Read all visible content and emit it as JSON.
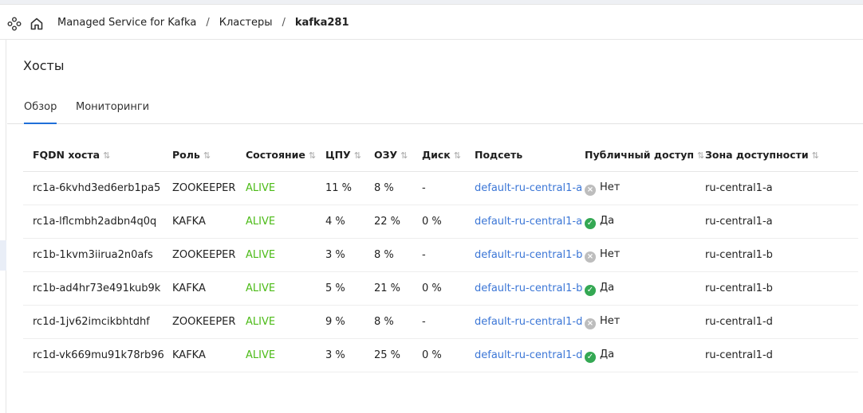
{
  "breadcrumb": {
    "items": [
      "Managed Service for Kafka",
      "Кластеры"
    ],
    "separator": "/",
    "current": "kafka281"
  },
  "page": {
    "title": "Хосты"
  },
  "tabs": [
    {
      "label": "Обзор",
      "active": true
    },
    {
      "label": "Мониторинги",
      "active": false
    }
  ],
  "table": {
    "sort_icon": "⇅",
    "columns": [
      {
        "label": "FQDN хоста",
        "sortable": true
      },
      {
        "label": "Роль",
        "sortable": true
      },
      {
        "label": "Состояние",
        "sortable": true
      },
      {
        "label": "ЦПУ",
        "sortable": true
      },
      {
        "label": "ОЗУ",
        "sortable": true
      },
      {
        "label": "Диск",
        "sortable": true
      },
      {
        "label": "Подсеть",
        "sortable": false
      },
      {
        "label": "Публичный доступ",
        "sortable": true
      },
      {
        "label": "Зона доступности",
        "sortable": true
      }
    ],
    "rows": [
      {
        "fqdn": "rc1a-6kvhd3ed6erb1pa5",
        "role": "ZOOKEEPER",
        "state": "ALIVE",
        "cpu": "11 %",
        "ram": "8 %",
        "disk": "-",
        "subnet": "default-ru-central1-a",
        "public": "Нет",
        "public_on": false,
        "zone": "ru-central1-a"
      },
      {
        "fqdn": "rc1a-lflcmbh2adbn4q0q",
        "role": "KAFKA",
        "state": "ALIVE",
        "cpu": "4 %",
        "ram": "22 %",
        "disk": "0 %",
        "subnet": "default-ru-central1-a",
        "public": "Да",
        "public_on": true,
        "zone": "ru-central1-a"
      },
      {
        "fqdn": "rc1b-1kvm3iirua2n0afs",
        "role": "ZOOKEEPER",
        "state": "ALIVE",
        "cpu": "3 %",
        "ram": "8 %",
        "disk": "-",
        "subnet": "default-ru-central1-b",
        "public": "Нет",
        "public_on": false,
        "zone": "ru-central1-b"
      },
      {
        "fqdn": "rc1b-ad4hr73e491kub9k",
        "role": "KAFKA",
        "state": "ALIVE",
        "cpu": "5 %",
        "ram": "21 %",
        "disk": "0 %",
        "subnet": "default-ru-central1-b",
        "public": "Да",
        "public_on": true,
        "zone": "ru-central1-b"
      },
      {
        "fqdn": "rc1d-1jv62imcikbhtdhf",
        "role": "ZOOKEEPER",
        "state": "ALIVE",
        "cpu": "9 %",
        "ram": "8 %",
        "disk": "-",
        "subnet": "default-ru-central1-d",
        "public": "Нет",
        "public_on": false,
        "zone": "ru-central1-d"
      },
      {
        "fqdn": "rc1d-vk669mu91k78rb96",
        "role": "KAFKA",
        "state": "ALIVE",
        "cpu": "3 %",
        "ram": "25 %",
        "disk": "0 %",
        "subnet": "default-ru-central1-d",
        "public": "Да",
        "public_on": true,
        "zone": "ru-central1-d"
      }
    ]
  },
  "colors": {
    "alive": "#4cbb17",
    "link": "#3b76d6",
    "accent": "#1f6fd8",
    "public_yes": "#34a853",
    "public_no": "#bdbdbd"
  }
}
